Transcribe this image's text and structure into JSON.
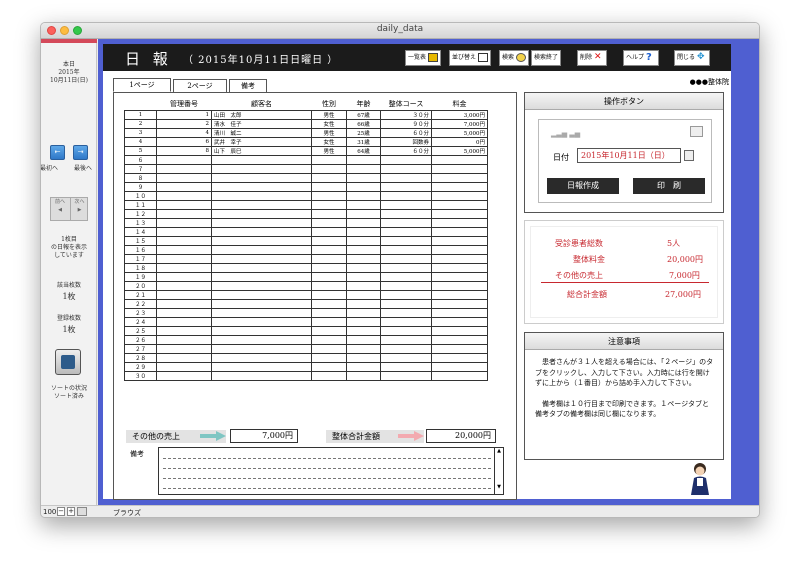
{
  "window": {
    "title": "daily_data"
  },
  "sidebar": {
    "today_label": "本日",
    "today_year": "2015年",
    "today_date": "10月11日(日)",
    "first_label": "最初へ",
    "last_label": "最後へ",
    "prev_label": "前へ",
    "next_label": "次へ",
    "page_info_1": "1枚目",
    "page_info_2": "の日報を表示",
    "page_info_3": "しています",
    "found_label": "該当枚数",
    "found_value": "1枚",
    "registered_label": "登録枚数",
    "registered_value": "1枚",
    "sort_label": "ソートの状況",
    "sort_value": "ソート済み"
  },
  "statusbar": {
    "zoom": "100",
    "mode": "ブラウズ"
  },
  "header": {
    "title": "日 報",
    "date": "（ 2015年10月11日日曜日 ）",
    "buttons": [
      "一覧表",
      "並び替え",
      "検索",
      "検索終了",
      "削除",
      "ヘルプ",
      "閉じる"
    ]
  },
  "clinic": "●●●整体院",
  "tabs": [
    "1ページ",
    "2ページ",
    "備考"
  ],
  "table": {
    "headers": [
      "",
      "管理番号",
      "顧客名",
      "性別",
      "年齢",
      "整体コース",
      "料金"
    ],
    "rows": [
      [
        "1",
        "1",
        "山田　太郎",
        "男性",
        "67歳",
        "３０分",
        "3,000円"
      ],
      [
        "2",
        "2",
        "清水　佳子",
        "女性",
        "66歳",
        "９０分",
        "7,000円"
      ],
      [
        "3",
        "4",
        "清川　誠二",
        "男性",
        "25歳",
        "６０分",
        "5,000円"
      ],
      [
        "4",
        "6",
        "武井　幸子",
        "女性",
        "31歳",
        "回数券",
        "0円"
      ],
      [
        "5",
        "8",
        "山下　辰巳",
        "男性",
        "64歳",
        "６０分",
        "5,000円"
      ],
      [
        "６",
        "",
        "",
        "",
        "",
        "",
        ""
      ],
      [
        "７",
        "",
        "",
        "",
        "",
        "",
        ""
      ],
      [
        "８",
        "",
        "",
        "",
        "",
        "",
        ""
      ],
      [
        "９",
        "",
        "",
        "",
        "",
        "",
        ""
      ],
      [
        "１０",
        "",
        "",
        "",
        "",
        "",
        ""
      ],
      [
        "１１",
        "",
        "",
        "",
        "",
        "",
        ""
      ],
      [
        "１２",
        "",
        "",
        "",
        "",
        "",
        ""
      ],
      [
        "１３",
        "",
        "",
        "",
        "",
        "",
        ""
      ],
      [
        "１４",
        "",
        "",
        "",
        "",
        "",
        ""
      ],
      [
        "１５",
        "",
        "",
        "",
        "",
        "",
        ""
      ],
      [
        "１６",
        "",
        "",
        "",
        "",
        "",
        ""
      ],
      [
        "１７",
        "",
        "",
        "",
        "",
        "",
        ""
      ],
      [
        "１８",
        "",
        "",
        "",
        "",
        "",
        ""
      ],
      [
        "１９",
        "",
        "",
        "",
        "",
        "",
        ""
      ],
      [
        "２０",
        "",
        "",
        "",
        "",
        "",
        ""
      ],
      [
        "２１",
        "",
        "",
        "",
        "",
        "",
        ""
      ],
      [
        "２２",
        "",
        "",
        "",
        "",
        "",
        ""
      ],
      [
        "２３",
        "",
        "",
        "",
        "",
        "",
        ""
      ],
      [
        "２４",
        "",
        "",
        "",
        "",
        "",
        ""
      ],
      [
        "２５",
        "",
        "",
        "",
        "",
        "",
        ""
      ],
      [
        "２６",
        "",
        "",
        "",
        "",
        "",
        ""
      ],
      [
        "２７",
        "",
        "",
        "",
        "",
        "",
        ""
      ],
      [
        "２８",
        "",
        "",
        "",
        "",
        "",
        ""
      ],
      [
        "２９",
        "",
        "",
        "",
        "",
        "",
        ""
      ],
      [
        "３０",
        "",
        "",
        "",
        "",
        "",
        ""
      ]
    ]
  },
  "summary": {
    "other_sales_label": "その他の売上",
    "other_sales_value": "7,000円",
    "total_label": "整体合計金額",
    "total_value": "20,000円"
  },
  "notes": {
    "label": "備考"
  },
  "ops": {
    "title": "操作ボタン",
    "date_label": "日付",
    "date_value": "2015年10月11日（日）",
    "create_button": "日報作成",
    "print_button": "印　刷"
  },
  "stats": {
    "patients_label": "受診患者総数",
    "patients_value": "5人",
    "fee_label": "整体料金",
    "fee_value": "20,000円",
    "other_label": "その他の売上",
    "other_value": "7,000円",
    "total_label": "総合計金額",
    "total_value": "27,000円"
  },
  "caution": {
    "title": "注意事項",
    "text1": "患者さんが３１人を超える場合には、「２ページ」のタブをクリックし、入力して下さい。入力時には行を開けずに上から（１番目）から詰め手入力して下さい。",
    "text2": "備考欄は１０行目まで印刷できます。１ページタブと備考タブの備考欄は同じ欄になります。"
  },
  "colors": {
    "accent_blue": "#4f5fd1",
    "header_black": "#1b1b1b",
    "stat_red": "#c7282f"
  }
}
